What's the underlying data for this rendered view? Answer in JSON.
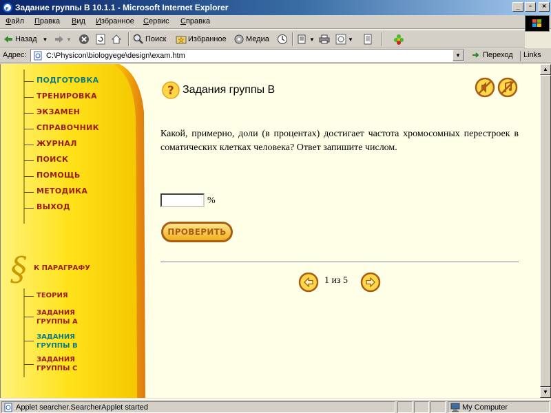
{
  "window": {
    "title": "Задание группы B 10.1.1 - Microsoft Internet Explorer",
    "controls": {
      "minimize": "_",
      "maximize": "▫",
      "close": "×"
    }
  },
  "menubar": {
    "items": [
      {
        "label": "Файл",
        "accel": "Ф",
        "rest": "айл"
      },
      {
        "label": "Правка",
        "accel": "П",
        "rest": "равка"
      },
      {
        "label": "Вид",
        "accel": "В",
        "rest": "ид"
      },
      {
        "label": "Избранное",
        "accel": "И",
        "rest": "збранное"
      },
      {
        "label": "Сервис",
        "accel": "С",
        "rest": "ервис"
      },
      {
        "label": "Справка",
        "accel": "С",
        "rest": "правка"
      }
    ]
  },
  "toolbar": {
    "back_label": "Назад",
    "search_label": "Поиск",
    "favorites_label": "Избранное",
    "media_label": "Медиа"
  },
  "addressbar": {
    "label": "Адрес:",
    "url": "C:\\Physicon\\biologyege\\design\\exam.htm",
    "go_label": "Переход",
    "links_label": "Links"
  },
  "sidebar": {
    "nav": [
      {
        "label": "ПОДГОТОВКА",
        "active": true
      },
      {
        "label": "ТРЕНИРОВКА",
        "active": false
      },
      {
        "label": "ЭКЗАМЕН",
        "active": false
      },
      {
        "label": "СПРАВОЧНИК",
        "active": false
      },
      {
        "label": "ЖУРНАЛ",
        "active": false
      },
      {
        "label": "ПОИСК",
        "active": false
      },
      {
        "label": "ПОМОЩЬ",
        "active": false
      },
      {
        "label": "МЕТОДИКА",
        "active": false
      },
      {
        "label": "ВЫХОД",
        "active": false
      }
    ],
    "paragraph_sign": "§",
    "paragraph_label": "К ПАРАГРАФУ",
    "sub": [
      {
        "label": "ТЕОРИЯ",
        "active": false
      },
      {
        "label": "ЗАДАНИЯ\nГРУППЫ А",
        "active": false
      },
      {
        "label": "ЗАДАНИЯ\nГРУППЫ В",
        "active": true
      },
      {
        "label": "ЗАДАНИЯ\nГРУППЫ С",
        "active": false
      }
    ]
  },
  "main": {
    "heading": "Задания группы B",
    "question": "Какой, примерно, доли (в процентах) достигает частота хромосомных перестроек в соматических клетках человека? Ответ запишите числом.",
    "answer_value": "",
    "unit": "%",
    "check_label": "ПРОВЕРИТЬ",
    "pager_text": "1 из 5"
  },
  "statusbar": {
    "text": "Applet searcher.SearcherApplet started",
    "zone": "My Computer"
  },
  "colors": {
    "nav_text": "#9c1c0f",
    "nav_active": "#0d7a82",
    "content_bg": "#ffffe8",
    "sidebar_yellow": "#ffe018",
    "accent_orange": "#e8a018"
  }
}
